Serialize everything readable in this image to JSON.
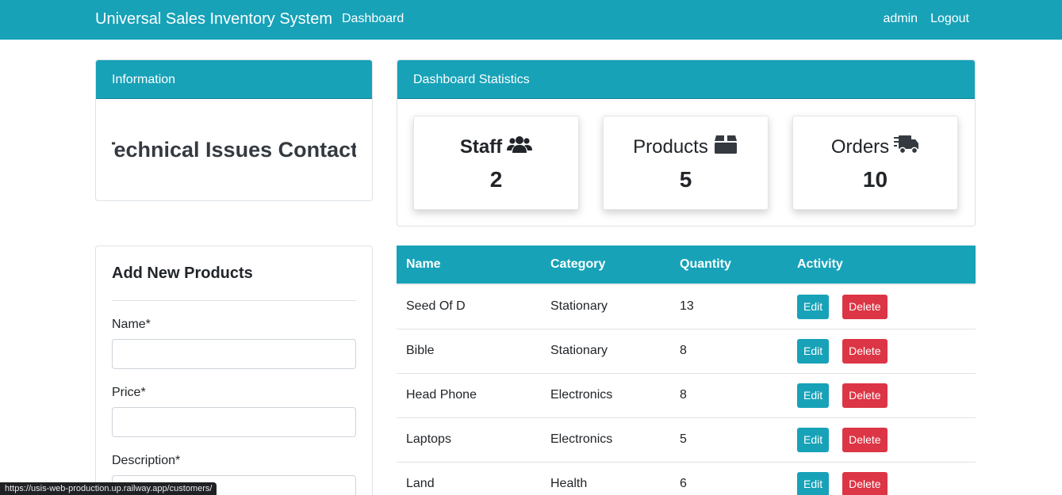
{
  "navbar": {
    "brand": "Universal Sales Inventory System",
    "dashboard": "Dashboard",
    "user": "admin",
    "logout": "Logout",
    "color": "#17a2b8"
  },
  "info": {
    "header": "Information",
    "marquee": "Technical Issues Contact Customer Support"
  },
  "stats": {
    "header": "Dashboard Statistics",
    "items": [
      {
        "label": "Staff",
        "value": "2",
        "icon": "users-icon"
      },
      {
        "label": "Products",
        "value": "5",
        "icon": "box-icon"
      },
      {
        "label": "Orders",
        "value": "10",
        "icon": "shipping-truck-icon"
      }
    ]
  },
  "add_product": {
    "title": "Add New Products",
    "name_label": "Name*",
    "price_label": "Price*",
    "description_label": "Description*"
  },
  "table": {
    "headers": [
      "Name",
      "Category",
      "Quantity",
      "Activity"
    ],
    "edit_label": "Edit",
    "delete_label": "Delete",
    "rows": [
      {
        "name": "Seed Of D",
        "category": "Stationary",
        "quantity": "13"
      },
      {
        "name": "Bible",
        "category": "Stationary",
        "quantity": "8"
      },
      {
        "name": "Head Phone",
        "category": "Electronics",
        "quantity": "8"
      },
      {
        "name": "Laptops",
        "category": "Electronics",
        "quantity": "5"
      },
      {
        "name": "Land",
        "category": "Health",
        "quantity": "6"
      }
    ]
  },
  "status_bar": {
    "url": "https://usis-web-production.up.railway.app/customers/"
  }
}
